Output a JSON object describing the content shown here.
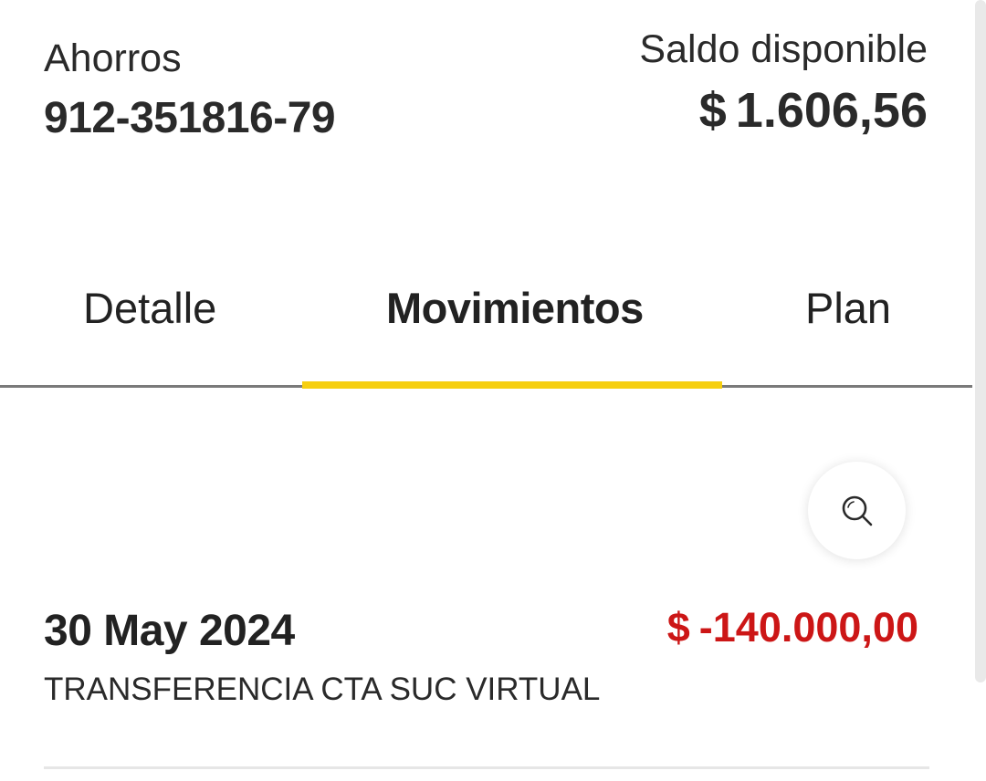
{
  "account": {
    "type": "Ahorros",
    "number": "912-351816-79"
  },
  "balance": {
    "label": "Saldo disponible",
    "currency": "$",
    "amount": "1.606,56"
  },
  "tabs": [
    {
      "label": "Detalle",
      "active": false
    },
    {
      "label": "Movimientos",
      "active": true
    },
    {
      "label": "Plan",
      "active": false
    }
  ],
  "search": {
    "icon": "search-icon"
  },
  "movements": [
    {
      "date": "30 May 2024",
      "description": "TRANSFERENCIA CTA SUC VIRTUAL",
      "currency": "$",
      "amount": "-140.000,00"
    }
  ],
  "colors": {
    "accent": "#f6cf10",
    "debit": "#cc1616",
    "text": "#222222"
  }
}
